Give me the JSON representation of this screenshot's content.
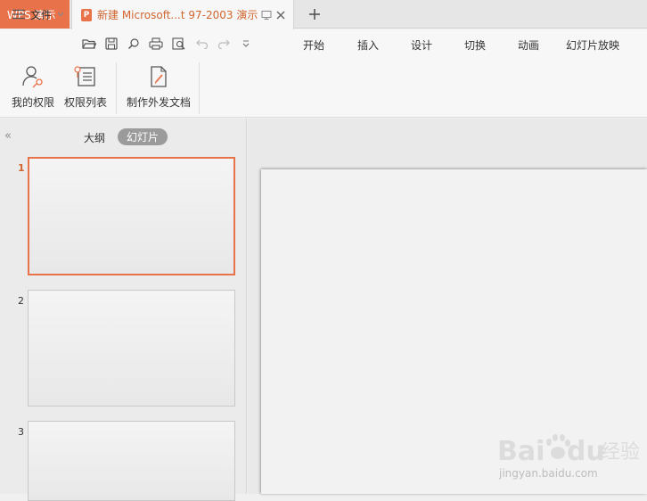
{
  "tabbar": {
    "app_tab_label": "WPS 演示",
    "doc_tab_title": "新建 Microsoft...t 97-2003 演示",
    "doc_icon_letter": "P"
  },
  "menu": {
    "file_label": "文件"
  },
  "ribbon_tabs": [
    "开始",
    "插入",
    "设计",
    "切换",
    "动画",
    "幻灯片放映"
  ],
  "ribbon_buttons": {
    "my_permission": "我的权限",
    "permission_list": "权限列表",
    "make_external_doc": "制作外发文档"
  },
  "left_panel": {
    "outline_tab": "大纲",
    "slides_tab": "幻灯片",
    "thumbnails": [
      "1",
      "2",
      "3"
    ]
  },
  "colors": {
    "accent": "#e8734b",
    "accent_text": "#d0652f"
  },
  "watermark": {
    "line2": "jingyan.baidu.com"
  }
}
